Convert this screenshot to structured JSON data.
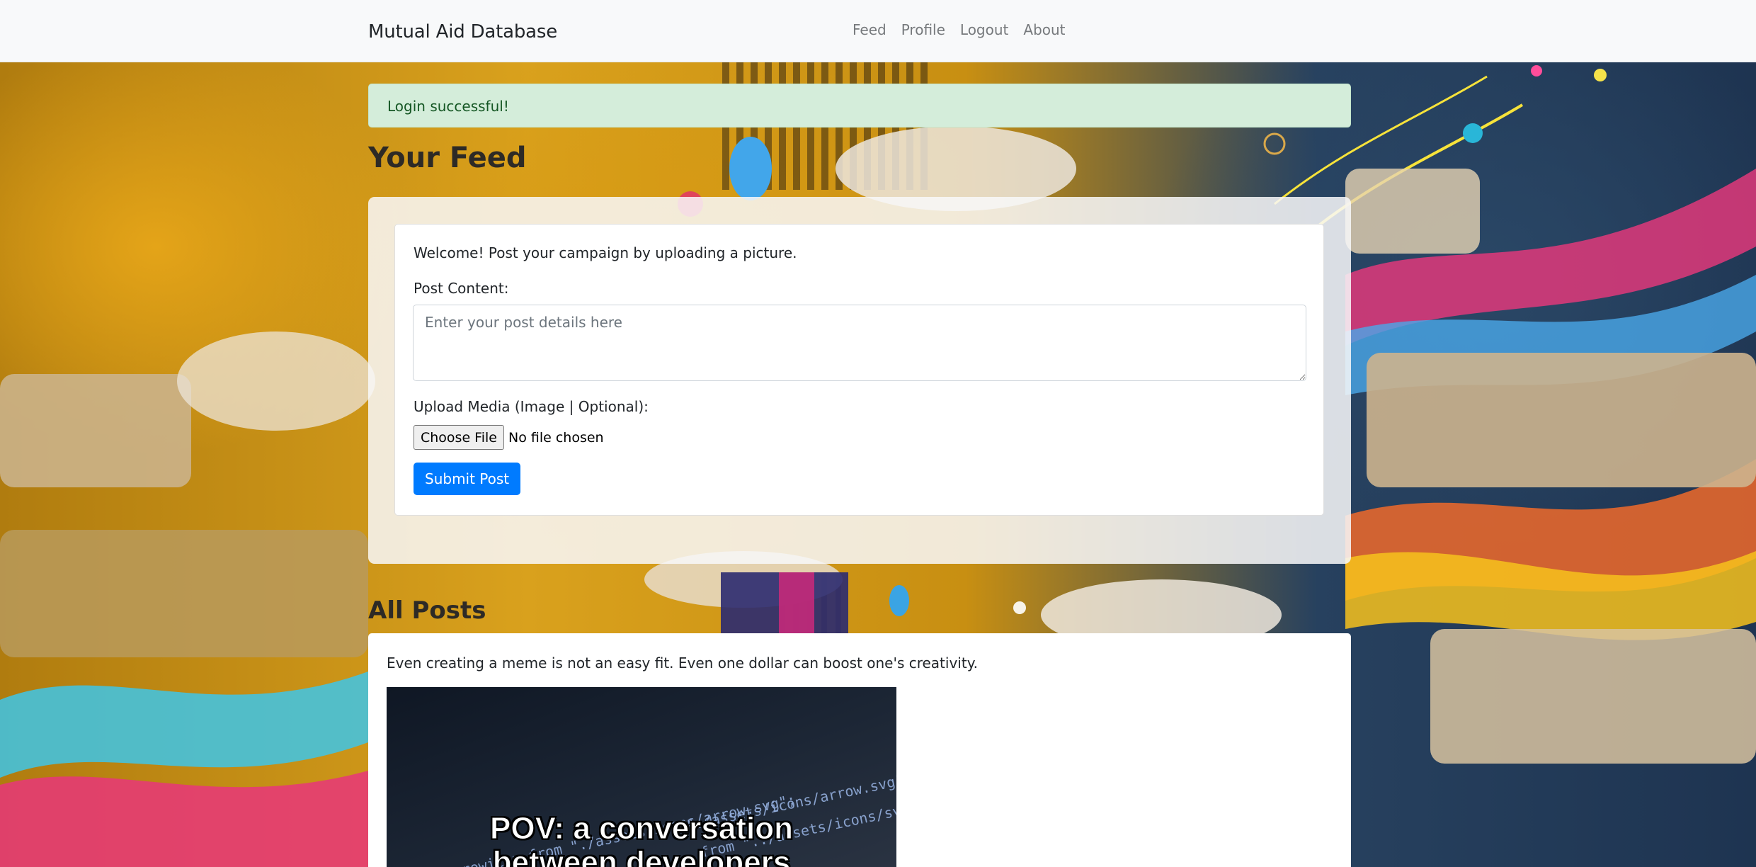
{
  "nav": {
    "brand": "Mutual Aid Database",
    "links": [
      "Feed",
      "Profile",
      "Logout",
      "About"
    ]
  },
  "alert": {
    "message": "Login successful!"
  },
  "feed": {
    "heading": "Your Feed",
    "welcome": "Welcome! Post your campaign by uploading a picture.",
    "content_label": "Post Content:",
    "content_placeholder": "Enter your post details here",
    "content_value": "",
    "media_label": "Upload Media (Image | Optional):",
    "file_button": "Choose File",
    "file_status": "No file chosen",
    "submit_label": "Submit Post"
  },
  "posts": {
    "heading": "All Posts",
    "items": [
      {
        "text": "Even creating a meme is not an easy fit. Even one dollar can boost one's creativity.",
        "image_caption_line1": "POV: a conversation",
        "image_caption_line2": "between developers",
        "image_code_lines": [
          "\"./assets/icons/arrow.svg\";",
          "mport as Arrowicon from \"./assets/icons/arrow.svg\";",
          "from \"../assets/icons/svg\";"
        ]
      }
    ]
  },
  "colors": {
    "navbar_bg": "#f8f9fa",
    "alert_bg": "#d4edda",
    "alert_text": "#155724",
    "primary": "#007bff"
  }
}
